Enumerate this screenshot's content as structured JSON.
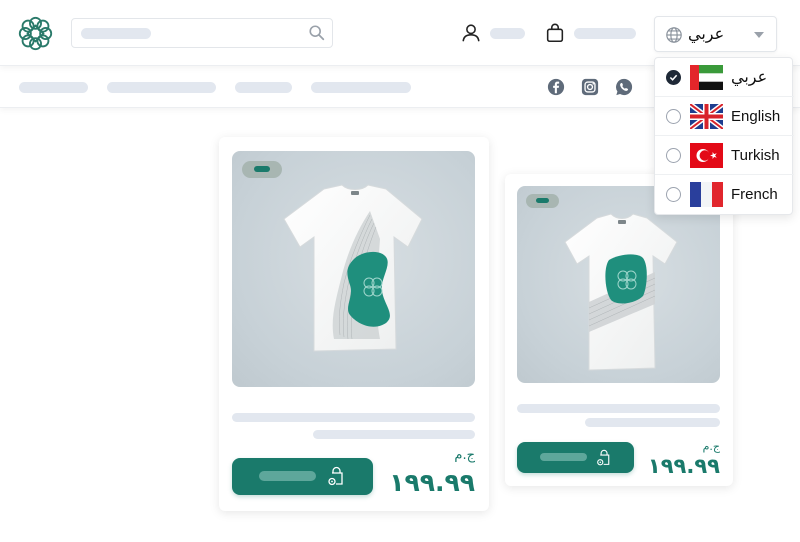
{
  "header": {
    "logo_icon": "knot-logo-icon",
    "search": {
      "placeholder": "",
      "icon": "search-icon"
    },
    "account_icon": "user-icon",
    "cart_icon": "shopping-bag-icon",
    "language_selector": {
      "selected_label": "عربي",
      "icon": "globe-icon",
      "caret": "chevron-down-icon"
    }
  },
  "subnav": {
    "social_icons": [
      "facebook-icon",
      "instagram-icon",
      "whatsapp-icon"
    ]
  },
  "language_dropdown": {
    "options": [
      {
        "label": "عربي",
        "flag": "uae-flag",
        "selected": true
      },
      {
        "label": "English",
        "flag": "uk-flag",
        "selected": false
      },
      {
        "label": "Turkish",
        "flag": "turkey-flag",
        "selected": false
      },
      {
        "label": "French",
        "flag": "france-flag",
        "selected": false
      }
    ]
  },
  "products": [
    {
      "price": "١٩٩.٩٩",
      "currency": "ج.م",
      "cart_icon": "add-to-cart-bag-icon"
    },
    {
      "price": "١٩٩.٩٩",
      "currency": "ج.م",
      "cart_icon": "add-to-cart-bag-icon"
    }
  ],
  "colors": {
    "brand": "#1a7a6b",
    "placeholder": "#e2e7ef",
    "badge": "#a8b6b2",
    "social": "#5f6b7a"
  }
}
